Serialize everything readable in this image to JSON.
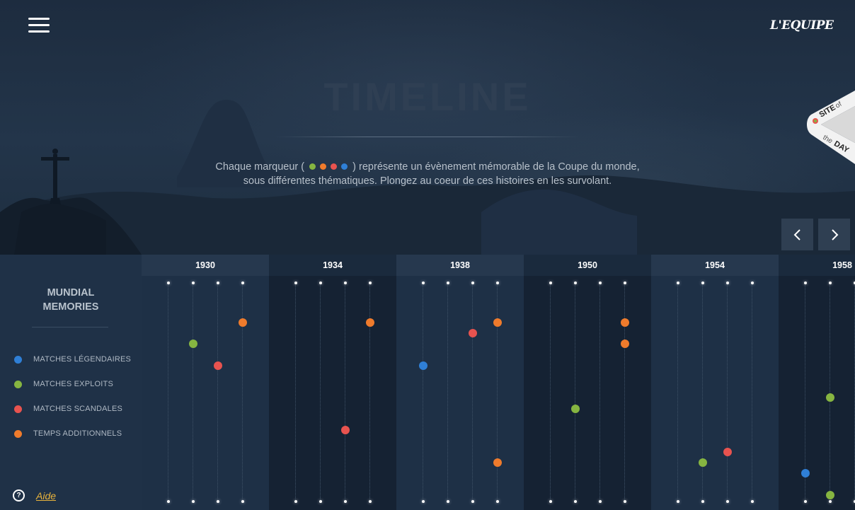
{
  "header": {
    "logo": "L'EQUIPE",
    "title": "TIMELINE",
    "intro_before": "Chaque marqueur (",
    "intro_after": ") représente un évènement mémorable de la Coupe du monde,",
    "intro_line2": "sous différentes thématiques. Plongez au coeur de ces histoires en les survolant.",
    "badge": {
      "line1": "SITE",
      "of": "of",
      "the": "the",
      "line2": "DAY"
    }
  },
  "colors": {
    "legendary": "#2f7fd6",
    "exploits": "#86b541",
    "scandales": "#e8534f",
    "temps": "#ef7b2c",
    "accent": "#e9b43c"
  },
  "icons": {
    "menu": "hamburger-icon",
    "prev": "chevron-left-icon",
    "next": "chevron-right-icon",
    "help": "question-circle-icon"
  },
  "sidebar": {
    "title_line1": "MUNDIAL",
    "title_line2": "MEMORIES",
    "legend": [
      {
        "label": "MATCHES LÉGENDAIRES",
        "category": "legendary"
      },
      {
        "label": "MATCHES EXPLOITS",
        "category": "exploits"
      },
      {
        "label": "MATCHES SCANDALES",
        "category": "scandales"
      },
      {
        "label": "TEMPS ADDITIONNELS",
        "category": "temps"
      }
    ],
    "help_label": "Aide"
  },
  "timeline": {
    "decades": [
      {
        "year": "1930",
        "shade": "light",
        "markers": [
          {
            "col": 3,
            "row": 1,
            "cat": "temps"
          },
          {
            "col": 1,
            "row": 2,
            "cat": "exploits"
          },
          {
            "col": 2,
            "row": 3,
            "cat": "scandales"
          },
          {
            "col": 0,
            "row": 10,
            "cat": "legendary"
          }
        ]
      },
      {
        "year": "1934",
        "shade": "dark",
        "markers": [
          {
            "col": 3,
            "row": 1,
            "cat": "temps"
          },
          {
            "col": 2,
            "row": 6,
            "cat": "scandales"
          }
        ]
      },
      {
        "year": "1938",
        "shade": "light",
        "markers": [
          {
            "col": 3,
            "row": 1,
            "cat": "temps"
          },
          {
            "col": 2,
            "row": 1.5,
            "cat": "scandales"
          },
          {
            "col": 0,
            "row": 3,
            "cat": "legendary"
          },
          {
            "col": 3,
            "row": 7.5,
            "cat": "temps"
          },
          {
            "col": 0,
            "row": 10,
            "cat": "legendary"
          }
        ]
      },
      {
        "year": "1950",
        "shade": "dark",
        "markers": [
          {
            "col": 3,
            "row": 1,
            "cat": "temps"
          },
          {
            "col": 3,
            "row": 2,
            "cat": "temps"
          },
          {
            "col": 1,
            "row": 5,
            "cat": "exploits"
          },
          {
            "col": 0,
            "row": 10,
            "cat": "legendary"
          }
        ]
      },
      {
        "year": "1954",
        "shade": "light",
        "markers": [
          {
            "col": 2,
            "row": 7,
            "cat": "scandales"
          },
          {
            "col": 1,
            "row": 7.5,
            "cat": "exploits"
          },
          {
            "col": 0,
            "row": 10,
            "cat": "legendary"
          }
        ]
      },
      {
        "year": "1958",
        "shade": "dark",
        "markers": [
          {
            "col": 1,
            "row": 4.5,
            "cat": "exploits"
          },
          {
            "col": 0,
            "row": 8,
            "cat": "legendary"
          },
          {
            "col": 1,
            "row": 9,
            "cat": "exploits"
          },
          {
            "col": 0,
            "row": 10,
            "cat": "legendary"
          }
        ]
      }
    ]
  }
}
